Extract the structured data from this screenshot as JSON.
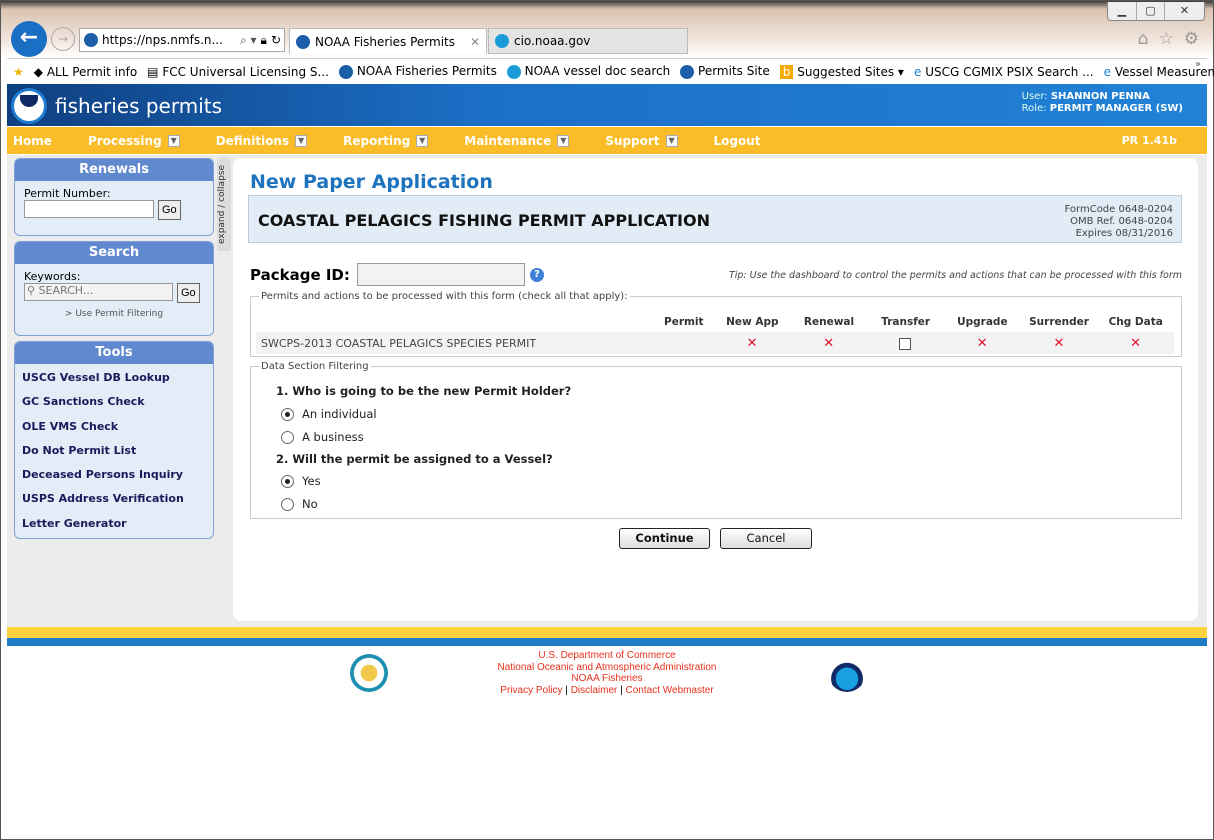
{
  "browser": {
    "url": "https://nps.nmfs.n...",
    "tabs": [
      {
        "title": "NOAA Fisheries Permits"
      },
      {
        "title": "cio.noaa.gov"
      }
    ],
    "favorites": [
      "ALL Permit info",
      "FCC Universal Licensing S...",
      "NOAA Fisheries Permits",
      "NOAA vessel doc search",
      "Permits Site",
      "Suggested Sites ▾",
      "USCG CGMIX PSIX Search ...",
      "Vessel Measurements"
    ]
  },
  "header": {
    "brand": "fisheries permits",
    "user_label": "User:",
    "user": "SHANNON PENNA",
    "role_label": "Role:",
    "role": "PERMIT MANAGER (SW)"
  },
  "nav": {
    "items": [
      "Home",
      "Processing",
      "Definitions",
      "Reporting",
      "Maintenance",
      "Support",
      "Logout"
    ],
    "version": "PR 1.41b"
  },
  "sidebar": {
    "renewals": {
      "title": "Renewals",
      "label": "Permit Number:",
      "go": "Go"
    },
    "search": {
      "title": "Search",
      "label": "Keywords:",
      "placeholder": "SEARCH...",
      "go": "Go",
      "filter_link": "> Use Permit Filtering"
    },
    "tools": {
      "title": "Tools",
      "items": [
        "USCG Vessel DB Lookup",
        "GC Sanctions Check",
        "OLE VMS Check",
        "Do Not Permit List",
        "Deceased Persons Inquiry",
        "USPS Address Verification",
        "Letter Generator"
      ]
    },
    "expand": "expand / collapse"
  },
  "main": {
    "title": "New Paper Application",
    "form_title": "COASTAL PELAGICS FISHING PERMIT APPLICATION",
    "form_meta": [
      "FormCode 0648-0204",
      "OMB Ref. 0648-0204",
      "Expires 08/31/2016"
    ],
    "package_label": "Package ID:",
    "package_value": "",
    "tip": "Tip: Use the dashboard to control the permits and actions that can be processed with this form",
    "permits_legend": "Permits and actions to be processed with this form (check all that apply):",
    "columns": [
      "Permit",
      "New App",
      "Renewal",
      "Transfer",
      "Upgrade",
      "Surrender",
      "Chg Data"
    ],
    "row": {
      "name": "SWCPS-2013 COASTAL PELAGICS SPECIES PERMIT",
      "cells": [
        "",
        "x",
        "x",
        "checkbox",
        "x",
        "x",
        "x"
      ]
    },
    "filter_legend": "Data Section Filtering",
    "q1": "1. Who is going to be the new Permit Holder?",
    "q1_options": [
      "An individual",
      "A business"
    ],
    "q1_selected": "An individual",
    "q2": "2. Will the permit be assigned to a Vessel?",
    "q2_options": [
      "Yes",
      "No"
    ],
    "q2_selected": "Yes",
    "continue": "Continue",
    "cancel": "Cancel"
  },
  "footer": {
    "links": [
      "U.S. Department of Commerce",
      "National Oceanic and Atmospheric Administration",
      "NOAA Fisheries"
    ],
    "bottom": [
      "Privacy Policy",
      "Disclaimer",
      "Contact Webmaster"
    ]
  }
}
